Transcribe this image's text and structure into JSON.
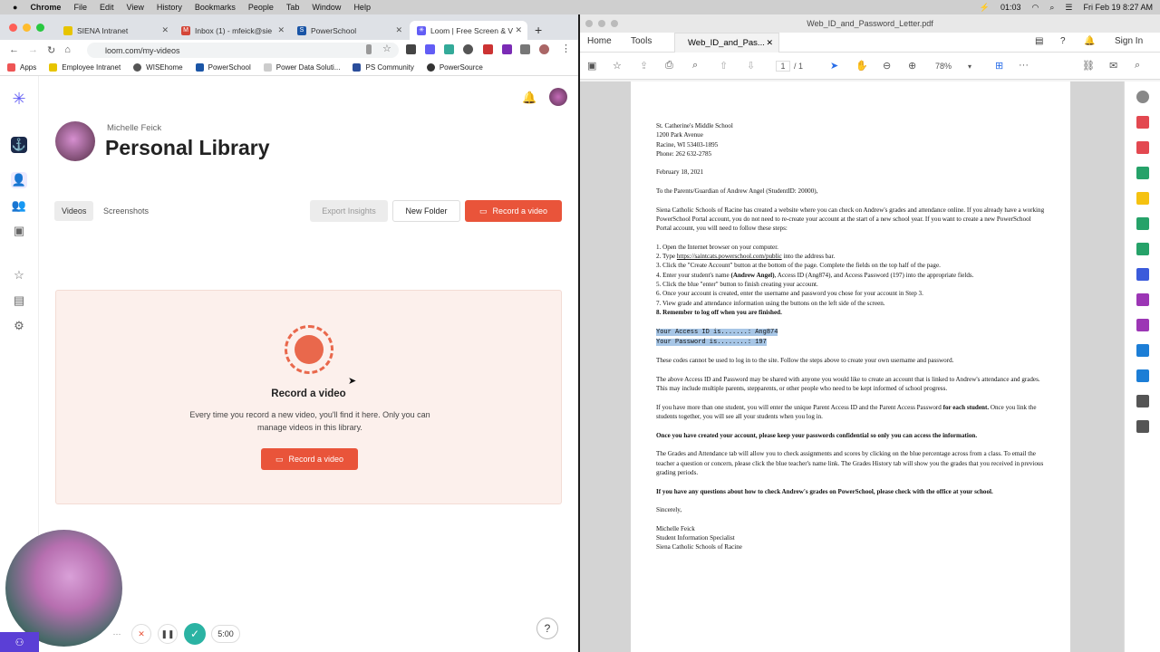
{
  "menubar": {
    "apple": "",
    "items": [
      "Chrome",
      "File",
      "Edit",
      "View",
      "History",
      "Bookmarks",
      "People",
      "Tab",
      "Window",
      "Help"
    ],
    "clock": "01:03",
    "datetime": "Fri Feb 19  8:27 AM"
  },
  "chrome": {
    "tabs": [
      {
        "label": "SIENA Intranet",
        "fav": "#e7c400"
      },
      {
        "label": "Inbox (1) - mfeick@sie",
        "fav": "#d44638"
      },
      {
        "label": "PowerSchool",
        "fav": "#1a55a6"
      },
      {
        "label": "Loom | Free Screen & V",
        "fav": "#625df5"
      }
    ],
    "url": "loom.com/my-videos",
    "bookmarks": [
      "Apps",
      "Employee Intranet",
      "WISEhome",
      "PowerSchool",
      "Power Data Soluti...",
      "PS Community",
      "PowerSource"
    ]
  },
  "loom": {
    "owner": "Michelle Feick",
    "title": "Personal Library",
    "tabs": [
      "Videos",
      "Screenshots"
    ],
    "export_label": "Export Insights",
    "new_folder_label": "New Folder",
    "record_label": "Record a video",
    "empty_title": "Record a video",
    "empty_desc": "Every time you record a new video, you'll find it here. Only you can manage videos in this library.",
    "empty_btn": "Record a video",
    "timer": "5:00",
    "help": "?",
    "more": "···"
  },
  "pdf": {
    "window_title": "Web_ID_and_Password_Letter.pdf",
    "tabs": {
      "home": "Home",
      "tools": "Tools",
      "doc": "Web_ID_and_Pas...",
      "signin": "Sign In"
    },
    "page_num": "1",
    "page_total": "/ 1",
    "zoom": "78%",
    "letter": {
      "header": [
        "St. Catherine's Middle School",
        "1200 Park Avenue",
        "Racine, WI 53403-1895",
        "Phone: 262 632-2785"
      ],
      "date": "February 18, 2021",
      "to": "To the Parents/Guardian of Andrew Angel (StudentID: 20000),",
      "intro": "Siena Catholic Schools of Racine has created a website where you can check on Andrew's grades and attendance online. If you already have a working PowerSchool Portal account, you do not need to re-create your account at the start of a new school year. If you want to create a new PowerSchool Portal account, you will need to follow these steps:",
      "step1": "1. Open the Internet browser on your computer.",
      "step2a": "2. Type ",
      "step2link": "https://saintcats.powerschool.com/public",
      "step2b": " into the address bar.",
      "step3": "3. Click the \"Create Account\" button at the bottom of the page. Complete the fields on the top half of the page.",
      "step4a": "4. Enter your student's name ",
      "step4name": "(Andrew Angel)",
      "step4b": ", Access ID (Ang874), and Access Password (197) into the appropriate fields.",
      "step5": "5. Click the blue \"enter\" button to finish creating your account.",
      "step6": "6. Once your account is created, enter the username and password you chose for your account in Step 3.",
      "step7": "7. View grade and attendance information using the buttons on the left side of the screen.",
      "step8": "8. Remember to log off when you are finished.",
      "access_id": "Your Access ID is.......: Ang874",
      "password": "Your Password is........: 197",
      "codes_note": "These codes cannot be used to log in to the site. Follow the steps above to create your own username and password.",
      "share": "The above Access ID and Password may be shared with anyone you would like to create an account that is linked to Andrew's attendance and grades. This may include multiple parents, stepparents, or other people who need to be kept informed of school progress.",
      "multi_a": "If you have more than one student, you will enter the unique Parent Access ID and the Parent Access Password ",
      "multi_b": "for each student.",
      "multi_c": " Once you link the students together, you will see all your students when you log in.",
      "confidential": "Once you have created your account, please keep your passwords confidential so only you can access the information.",
      "grades": "The Grades and Attendance tab will allow you to check assignments and scores by clicking on the blue percentage across from a class. To email the teacher a question or concern, please click the blue teacher's name link. The Grades History tab will show you the grades that you received in previous grading periods.",
      "questions": "If you have any questions about how to check Andrew's grades on PowerSchool, please check with the office at your school.",
      "closing": "Sincerely,",
      "sig": [
        "Michelle Feick",
        "Student Information Specialist",
        "Siena Catholic Schools of Racine"
      ]
    }
  }
}
